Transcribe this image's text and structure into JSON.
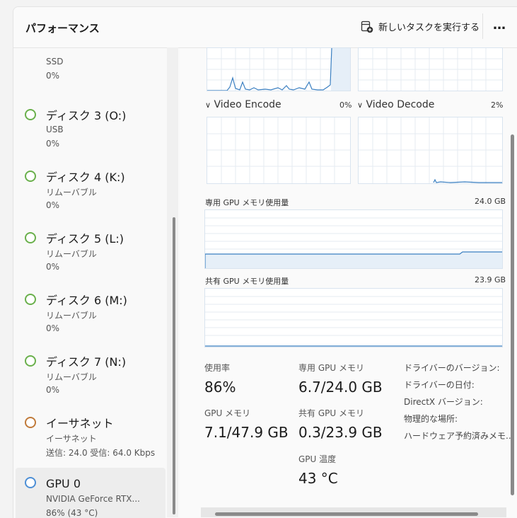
{
  "window": {
    "title": "パフォーマンス",
    "run_task_label": "新しいタスクを実行する",
    "more_label": "…"
  },
  "sidebar": {
    "items": [
      {
        "name": "",
        "sub": "SSD",
        "value": "0%",
        "status": "green"
      },
      {
        "name": "ディスク 3 (O:)",
        "sub": "USB",
        "value": "0%",
        "status": "green"
      },
      {
        "name": "ディスク 4 (K:)",
        "sub": "リムーバブル",
        "value": "0%",
        "status": "green"
      },
      {
        "name": "ディスク 5 (L:)",
        "sub": "リムーバブル",
        "value": "0%",
        "status": "green"
      },
      {
        "name": "ディスク 6 (M:)",
        "sub": "リムーバブル",
        "value": "0%",
        "status": "green"
      },
      {
        "name": "ディスク 7 (N:)",
        "sub": "リムーバブル",
        "value": "0%",
        "status": "green"
      },
      {
        "name": "イーサネット",
        "sub": "イーサネット",
        "value": "送信: 24.0  受信: 64.0 Kbps",
        "status": "orange"
      },
      {
        "name": "GPU 0",
        "sub": "NVIDIA GeForce RTX...",
        "value": "86% (43 °C)",
        "status": "blue"
      }
    ]
  },
  "engines": {
    "video_encode": {
      "label": "Video Encode",
      "value": "0%"
    },
    "video_decode": {
      "label": "Video Decode",
      "value": "2%"
    }
  },
  "memory_graphs": {
    "dedicated": {
      "label": "専用 GPU メモリ使用量",
      "max": "24.0 GB"
    },
    "shared": {
      "label": "共有 GPU メモリ使用量",
      "max": "23.9 GB"
    }
  },
  "stats": {
    "usage": {
      "label": "使用率",
      "value": "86%"
    },
    "dedicated": {
      "label": "専用 GPU メモリ",
      "value": "6.7/24.0 GB"
    },
    "gpu_memory": {
      "label": "GPU メモリ",
      "value": "7.1/47.9 GB"
    },
    "shared": {
      "label": "共有 GPU メモリ",
      "value": "0.3/23.9 GB"
    },
    "temperature": {
      "label": "GPU 温度",
      "value": "43 °C"
    }
  },
  "info_labels": [
    "ドライバーのバージョン:",
    "ドライバーの日付:",
    "DirectX バージョン:",
    "物理的な場所:",
    "ハードウェア予約済みメモ..."
  ],
  "colors": {
    "graph_line": "#3a7fc1",
    "graph_fill": "#e6eff8",
    "grid": "#e4ebf2"
  }
}
